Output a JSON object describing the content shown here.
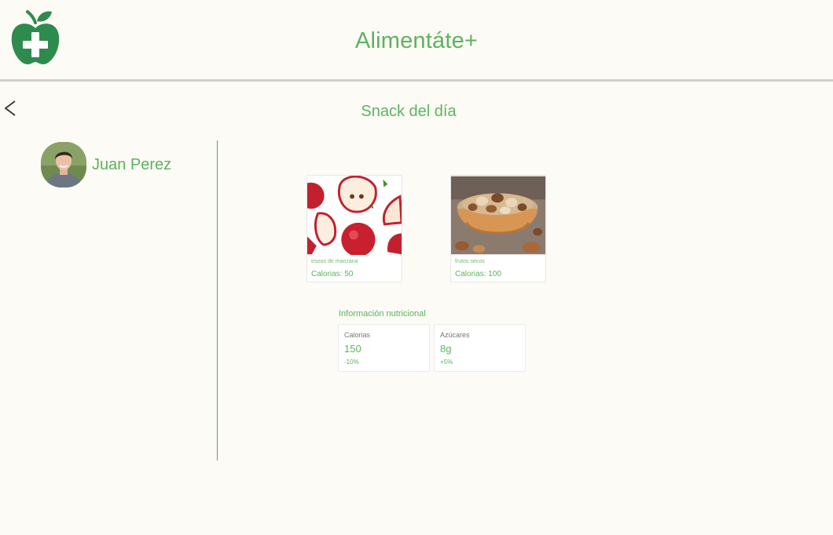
{
  "header": {
    "title": "Alimentáte+",
    "logo_icon": "apple-plus-icon"
  },
  "nav": {
    "back_icon": "chevron-left-icon"
  },
  "page": {
    "title": "Snack del día"
  },
  "user": {
    "name": "Juan Perez"
  },
  "snacks": [
    {
      "name": "trozos de manzana",
      "calories": "Calorias: 50"
    },
    {
      "name": "frutos secos",
      "calories": "Calorias: 100"
    }
  ],
  "nutrition": {
    "title": "Información nutricional",
    "stats": [
      {
        "label": "Calorias",
        "value": "150",
        "delta": "-10%"
      },
      {
        "label": "Azúcares",
        "value": "8g",
        "delta": "+5%"
      }
    ]
  },
  "colors": {
    "accent": "#5cb35e",
    "logo": "#2e8b4e",
    "background": "#fdfbf6"
  }
}
